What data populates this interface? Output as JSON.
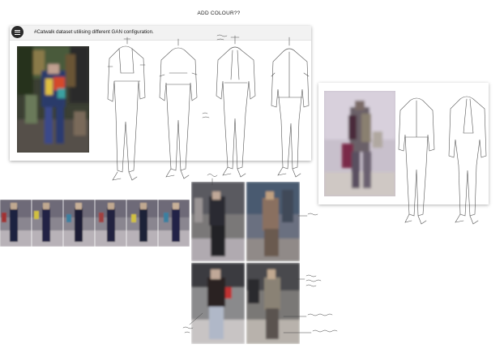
{
  "page": {
    "title": "ADD COLOUR??"
  },
  "card": {
    "caption": "#Catwalk dataset utilising different GAN configuration.",
    "menu_icon": "menu-icon"
  },
  "colors": {
    "card_header": "#f2f2f2",
    "menu_button": "#2a2a2a",
    "card_shadow": "#999999"
  },
  "strip": {
    "frame_count": 6
  },
  "grid": {
    "cell_count": 4
  }
}
